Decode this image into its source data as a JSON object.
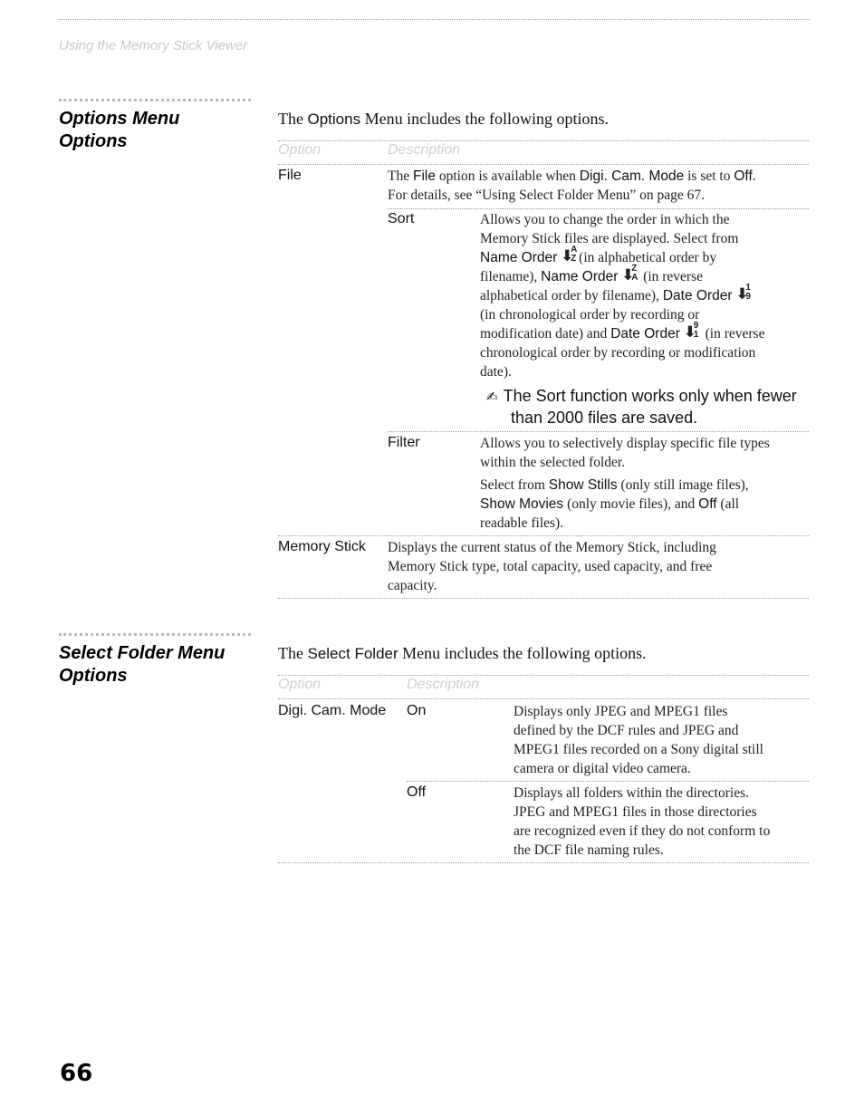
{
  "running_head": "Using the Memory Stick Viewer",
  "page_number": "66",
  "sections": [
    {
      "title_lines": [
        "Options Menu",
        "Options"
      ],
      "intro": {
        "pre": "The ",
        "keyword": "Options",
        "post": " Menu includes the following options."
      },
      "table_headers": {
        "option": "Option",
        "description": "Description"
      },
      "rows": {
        "file": {
          "option": "File",
          "line1": {
            "pre": "The ",
            "kw1": "File",
            "mid": " option is available when ",
            "kw2": "Digi. Cam. Mode",
            "mid2": " is set to ",
            "kw3": "Off",
            "post": "."
          },
          "line2": "For details, see “Using Select Folder Menu” on page 67.",
          "sub": {
            "sort": {
              "option": "Sort",
              "l1": "Allows you to change the order in which the",
              "l2": "Memory Stick files are displayed. Select from",
              "l3_kw": "Name Order",
              "l3_post": "(in alphabetical order by",
              "l4_pre": "filename), ",
              "l4_kw": "Name Order",
              "l4_post": " (in reverse",
              "l5_pre": "alphabetical order by filename), ",
              "l5_kw": "Date Order",
              "l6": "(in chronological order by recording or",
              "l7_pre": "modification date) and ",
              "l7_kw": "Date Order",
              "l7_post": " (in reverse",
              "l8": "chronological order by recording or modification",
              "l9": "date).",
              "icons": {
                "name_asc": {
                  "icon": "sort-down-arrow",
                  "top": "A",
                  "bottom": "Z"
                },
                "name_desc": {
                  "icon": "sort-down-arrow",
                  "top": "Z",
                  "bottom": "A"
                },
                "date_asc": {
                  "icon": "sort-down-arrow",
                  "top": "1",
                  "bottom": "9"
                },
                "date_desc": {
                  "icon": "sort-down-arrow",
                  "top": "9",
                  "bottom": "1"
                }
              },
              "arrow_glyph": "⬇",
              "note": {
                "icon": "note-pencil",
                "glyph": "✍",
                "pre": "The ",
                "kw": "Sort",
                "post": " function works only when fewer",
                "line2": "than 2000 files are saved."
              }
            },
            "filter": {
              "option": "Filter",
              "l1": "Allows you to selectively display specific file types",
              "l2": "within the selected folder.",
              "l3_pre": "Select from ",
              "l3_kw": "Show Stills",
              "l3_post": " (only still image files),",
              "l4_kw": "Show Movies",
              "l4_mid": " (only movie files), and ",
              "l4_kw2": "Off",
              "l4_post": " (all",
              "l5": "readable files)."
            }
          }
        },
        "memory_stick": {
          "option": "Memory Stick",
          "l1": "Displays the current status of the Memory Stick, including",
          "l2": "Memory Stick type, total capacity, used capacity, and free",
          "l3": "capacity."
        }
      }
    },
    {
      "title_lines": [
        "Select Folder Menu",
        "Options"
      ],
      "intro": {
        "pre": "The ",
        "keyword": "Select Folder",
        "post": " Menu includes the following options."
      },
      "table_headers": {
        "option": "Option",
        "description": "Description"
      },
      "rows": {
        "digicam": {
          "option": "Digi. Cam. Mode",
          "on": {
            "value": "On",
            "l1": "Displays only JPEG and MPEG1 files",
            "l2": "defined by the DCF rules and JPEG and",
            "l3": "MPEG1 files recorded on a Sony digital still",
            "l4": "camera or digital video camera."
          },
          "off": {
            "value": "Off",
            "l1": "Displays all folders within the directories.",
            "l2": "JPEG and MPEG1 files in those directories",
            "l3": "are recognized even if they do not conform to",
            "l4": "the DCF file naming rules."
          }
        }
      }
    }
  ]
}
